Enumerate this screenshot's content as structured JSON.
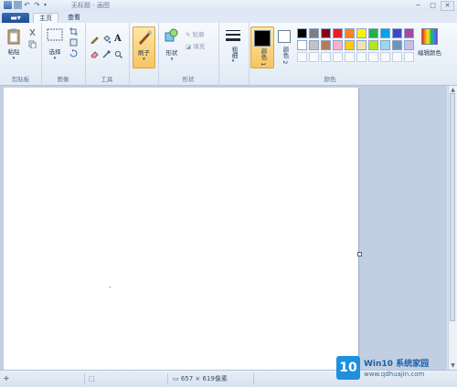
{
  "window": {
    "title": "无标题 - 画图",
    "minimize_label": "─",
    "maximize_label": "□",
    "close_label": "✕"
  },
  "tabs": {
    "file_label": "▬▾",
    "home": "主页",
    "view": "查看"
  },
  "groups": {
    "clipboard": {
      "label": "剪贴板",
      "paste": "粘贴"
    },
    "image": {
      "label": "图像",
      "select": "选择"
    },
    "tools": {
      "label": "工具"
    },
    "brushes": {
      "label": "刷子"
    },
    "shapes": {
      "label": "形状",
      "shapes_btn": "形状",
      "outline": "轮廓",
      "fill": "填充"
    },
    "size": {
      "label": "粗细"
    },
    "colors": {
      "label": "颜色",
      "color1": "颜色 1",
      "color2": "颜色 2",
      "edit_colors": "编辑颜色",
      "palette_row1": [
        "#000000",
        "#7f7f7f",
        "#880015",
        "#ed1c24",
        "#ff7f27",
        "#fff200",
        "#22b14c",
        "#00a2e8",
        "#3f48cc",
        "#a349a4"
      ],
      "palette_row2": [
        "#ffffff",
        "#c3c3c3",
        "#b97a57",
        "#ffaec9",
        "#ffc90e",
        "#efe4b0",
        "#b5e61d",
        "#99d9ea",
        "#7092be",
        "#c8bfe7"
      ],
      "color1_value": "#000000",
      "color2_value": "#ffffff"
    }
  },
  "status": {
    "cursor_icon": "crosshair-icon",
    "selection_icon": "selection-icon",
    "size_text": "657 × 619像素"
  },
  "watermark": {
    "logo_text": "10",
    "brand": "Win10 系统家园",
    "url": "www.qdhuajin.com"
  }
}
